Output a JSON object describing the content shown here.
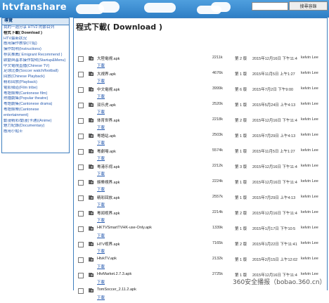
{
  "header": {
    "logo": "htvfanshare",
    "search_placeholder": "",
    "search_button": "搜尋容錄"
  },
  "sidebar": {
    "title": "導覽",
    "items": [
      {
        "label": "我的一週分享 HTV2 的節目列",
        "active": false
      },
      {
        "label": "程式下載( Download )",
        "active": true
      },
      {
        "label": "HTV最新狀況",
        "active": false
      },
      {
        "label": "應用操作教學(介紹)",
        "active": false
      },
      {
        "label": "操作說明(Instructions)",
        "active": false
      },
      {
        "label": "移民推薦( Emigrant Recommend )",
        "active": false
      },
      {
        "label": "啟動與基本操作說明(Startup&Menu)",
        "active": false
      },
      {
        "label": "中文電視直播(Chinese TV)",
        "active": false
      },
      {
        "label": "足球比賽(Soccer watch/football)",
        "active": false
      },
      {
        "label": "回放(Chinese Playback)",
        "active": false
      },
      {
        "label": "精彩回放(Playback)",
        "active": false
      },
      {
        "label": "電影頻道(Film tribe)",
        "active": false
      },
      {
        "label": "粵語娛樂(Cantonese film)",
        "active": false
      },
      {
        "label": "熱播劇集(Popular theatre)",
        "active": false
      },
      {
        "label": "粵語劇集(Cantonese drama)",
        "active": false
      },
      {
        "label": "粵語娛樂(Cantonese",
        "active": false
      },
      {
        "label": "entertainment)",
        "active": false
      },
      {
        "label": "動漫精彩/動漫(卡通)(Anime)",
        "active": false
      },
      {
        "label": "魅力紀錄(Documentary)",
        "active": false
      },
      {
        "label": "應用小貼士",
        "active": false
      }
    ]
  },
  "main": {
    "title": "程式下載( Download )",
    "download_label": "下載",
    "files": [
      {
        "name": "大陸電視.apk",
        "size": "2211k",
        "version": "第 2 版",
        "date": "2015年12月16日 下午11:4",
        "uploader": "kelvin Lee"
      },
      {
        "name": "大視界.apk",
        "size": "4676k",
        "version": "第 1 版",
        "date": "2015年11月5日 上午1:27",
        "uploader": "kelvin Lee"
      },
      {
        "name": "中文電視.apk",
        "size": "3999k",
        "version": "第 6 版",
        "date": "2015年7月2日 下午9:00",
        "uploader": "kelvin Lee"
      },
      {
        "name": "双乐虎.apk",
        "size": "2520k",
        "version": "第 1 版",
        "date": "2015年5月24日 上午4:13",
        "uploader": "kelvin Lee"
      },
      {
        "name": "体育世界.apk",
        "size": "2218k",
        "version": "第 2 版",
        "date": "2015年12月16日 下午11:4",
        "uploader": "kelvin Lee"
      },
      {
        "name": "粵語站.apk",
        "size": "2503k",
        "version": "第 1 版",
        "date": "2015年7月29日 上午4:13",
        "uploader": "kelvin Lee"
      },
      {
        "name": "粵劇場.apk",
        "size": "5574k",
        "version": "第 1 版",
        "date": "2015年11月5日 上午1:27",
        "uploader": "kelvin Lee"
      },
      {
        "name": "粵港乐视.apk",
        "size": "2212k",
        "version": "第 3 版",
        "date": "2015年12月16日 下午11:4",
        "uploader": "kelvin Lee"
      },
      {
        "name": "娛樂視界.apk",
        "size": "2224k",
        "version": "第 1 版",
        "date": "2015年12月16日 下午11:4",
        "uploader": "kelvin Lee"
      },
      {
        "name": "精彩回放.apk",
        "size": "2557k",
        "version": "第 1 版",
        "date": "2015年7月29日 上午4:13",
        "uploader": "kelvin Lee"
      },
      {
        "name": "粵闻视界.apk",
        "size": "2214k",
        "version": "第 2 版",
        "date": "2015年12月16日 下午11:4",
        "uploader": "kelvin Lee"
      },
      {
        "name": "HKTVSmartTVHK-use-Only.apk",
        "size": "1339k",
        "version": "第 1 版",
        "date": "2015年1月17日 下午10:5",
        "uploader": "kelvin Lee"
      },
      {
        "name": "HTV视界.apk",
        "size": "7165k",
        "version": "第 2 版",
        "date": "2015年1月22日 下午11:41",
        "uploader": "kelvin Lee"
      },
      {
        "name": "HtvkTV.apk",
        "size": "2132k",
        "version": "第 1 版",
        "date": "2015年2月15日 上午12:02",
        "uploader": "kelvin Lee"
      },
      {
        "name": "HtvMarket.2.7.3.apk",
        "size": "2725k",
        "version": "第 1 版",
        "date": "2015年12月16日 下午11:4",
        "uploader": "kelvin Lee"
      },
      {
        "name": "TomSoccer_2.11.2.apk",
        "size": "",
        "version": "",
        "date": "",
        "uploader": ""
      }
    ]
  },
  "watermark": "360安全播报（bobao.360.cn）",
  "colors": {
    "header_blue": "#2f7fc6",
    "border_blue": "#3f7fbf",
    "link_blue": "#2a5db0"
  }
}
